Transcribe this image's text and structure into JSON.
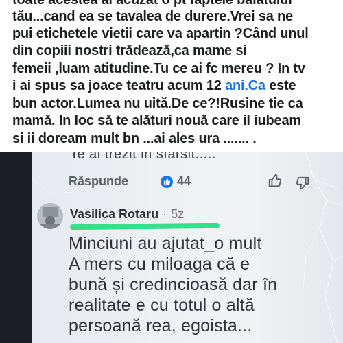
{
  "post": {
    "lines": [
      "toate acestea al acuzat o pt faptele balatului",
      "tău...cand ea se tavalea de durere.Vrei sa ne",
      "pui etichetele vietii care va apartin ?Când unul",
      "din copiii nostri trădează,ca mame si",
      "femeii  ,luam atitudine.Tu ce ai fc mereu ? In tv",
      "i ai spus sa joace teatru acum 12 ",
      "bun actor.Lumea nu uită.De ce?!Rusine tie ca",
      "mamă. In loc să te alături  nouă care il iubeam",
      "si ii doream mult bn ...ai  ales ura ....... ."
    ],
    "link_text": "ani.Ca",
    "line6_tail": " este"
  },
  "screen": {
    "prev_comment_tail": "Te ai trezit in sfarsit.....",
    "reply_label": "Răspunde",
    "like_count": "44",
    "comment": {
      "author": "Vasilica Rotaru",
      "separator": "·",
      "time": "5z",
      "lines": [
        "Minciuni au ajutat_o mult",
        "A mers cu miloaga că e",
        "bună și credincioasă dar în",
        "realitate e cu totul o altă",
        "persoană rea, egoista..."
      ]
    }
  },
  "colors": {
    "link": "#1a73e8",
    "like_blue": "#1877f2",
    "highlight_green": "#32e08a"
  },
  "icons": [
    "like-thumb-icon",
    "thumbs-up-icon",
    "thumbs-down-icon",
    "avatar"
  ]
}
